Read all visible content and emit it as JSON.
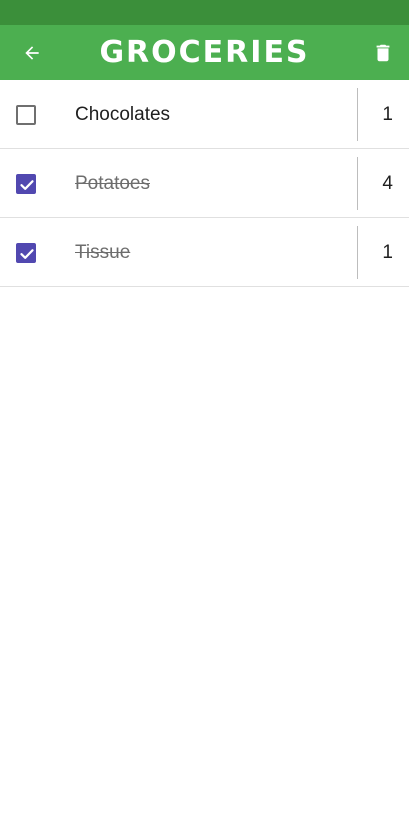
{
  "app_bar": {
    "title": "GROCERIES",
    "back_icon": "arrow-left-icon",
    "delete_icon": "trash-icon"
  },
  "items": [
    {
      "name": "Chocolates",
      "checked": false,
      "quantity": "1"
    },
    {
      "name": "Potatoes",
      "checked": true,
      "quantity": "4"
    },
    {
      "name": "Tissue",
      "checked": true,
      "quantity": "1"
    }
  ],
  "colors": {
    "status_bar": "#3b8f3a",
    "app_bar": "#4caf50",
    "checkbox_checked": "#5148b0"
  }
}
